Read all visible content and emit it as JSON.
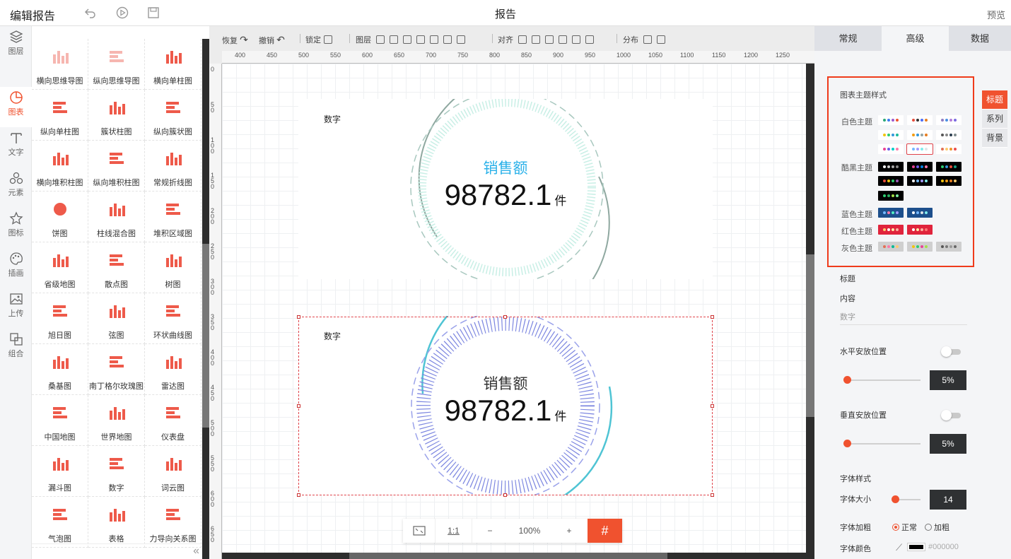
{
  "header": {
    "app_title": "编辑报告",
    "doc_title": "报告",
    "preview_label": "预览",
    "icons": [
      "undo-icon",
      "play-icon",
      "save-icon"
    ]
  },
  "leftnav": [
    {
      "label": "图层",
      "icon": "layers-icon"
    },
    {
      "label": "图表",
      "icon": "chart-icon"
    },
    {
      "label": "文字",
      "icon": "text-icon"
    },
    {
      "label": "元素",
      "icon": "elements-icon"
    },
    {
      "label": "图标",
      "icon": "star-icon"
    },
    {
      "label": "插画",
      "icon": "palette-icon"
    },
    {
      "label": "上传",
      "icon": "upload-icon"
    },
    {
      "label": "组合",
      "icon": "group-icon"
    }
  ],
  "charts": [
    "横向思维导图",
    "纵向思维导图",
    "横向单柱图",
    "纵向单柱图",
    "簇状柱图",
    "纵向簇状图",
    "横向堆积柱图",
    "纵向堆积柱图",
    "常规折线图",
    "饼图",
    "柱线混合图",
    "堆积区域图",
    "省级地图",
    "散点图",
    "树图",
    "旭日图",
    "弦图",
    "环状曲线图",
    "桑基图",
    "南丁格尔玫瑰图",
    "雷达图",
    "中国地图",
    "世界地图",
    "仪表盘",
    "漏斗图",
    "数字",
    "词云图",
    "气泡图",
    "表格",
    "力导向关系图"
  ],
  "toolbar": {
    "redo": "恢复",
    "undo": "撤销",
    "lock": "锁定",
    "layer": "图层",
    "align": "对齐",
    "distribute": "分布"
  },
  "ruler": {
    "h": [
      "400",
      "450",
      "500",
      "550",
      "600",
      "650",
      "700",
      "750",
      "800",
      "850",
      "900",
      "950",
      "1000",
      "1050",
      "1100",
      "1150",
      "1200",
      "1250"
    ],
    "v": [
      "0",
      "50",
      "100",
      "150",
      "200",
      "250",
      "300",
      "350",
      "400",
      "450",
      "500",
      "550",
      "600",
      "650"
    ]
  },
  "widgets": [
    {
      "label": "数字",
      "title": "销售额",
      "value": "98782.1",
      "unit": "件",
      "title_color": "#2ab1e9"
    },
    {
      "label": "数字",
      "title": "销售额",
      "value": "98782.1",
      "unit": "件",
      "title_color": "#333333"
    }
  ],
  "zoom": {
    "fit_icon": "fit-screen-icon",
    "one_to_one": "1:1",
    "minus": "−",
    "value": "100%",
    "plus": "+",
    "grid_icon": "grid-icon"
  },
  "rightpanel": {
    "tabs": [
      "常规",
      "高级",
      "数据"
    ],
    "active_tab": "高级",
    "sidetabs": [
      "标题",
      "系列",
      "背景"
    ],
    "theme_header": "图表主题样式",
    "theme_groups": [
      "白色主题",
      "酷黑主题",
      "蓝色主题",
      "红色主题",
      "灰色主题"
    ],
    "title_section": "标题",
    "content_label": "内容",
    "content_value": "数字",
    "h_position_label": "水平安放位置",
    "h_position_value": "5%",
    "v_position_label": "垂直安放位置",
    "v_position_value": "5%",
    "font_style_label": "字体样式",
    "font_size_label": "字体大小",
    "font_size_value": "14",
    "font_weight_label": "字体加粗",
    "weight_normal": "正常",
    "weight_bold": "加粗",
    "font_color_label": "字体颜色",
    "font_color_value": "#000000"
  },
  "colors": {
    "accent": "#f0522f",
    "highlight_box": "#ef3b1b"
  }
}
